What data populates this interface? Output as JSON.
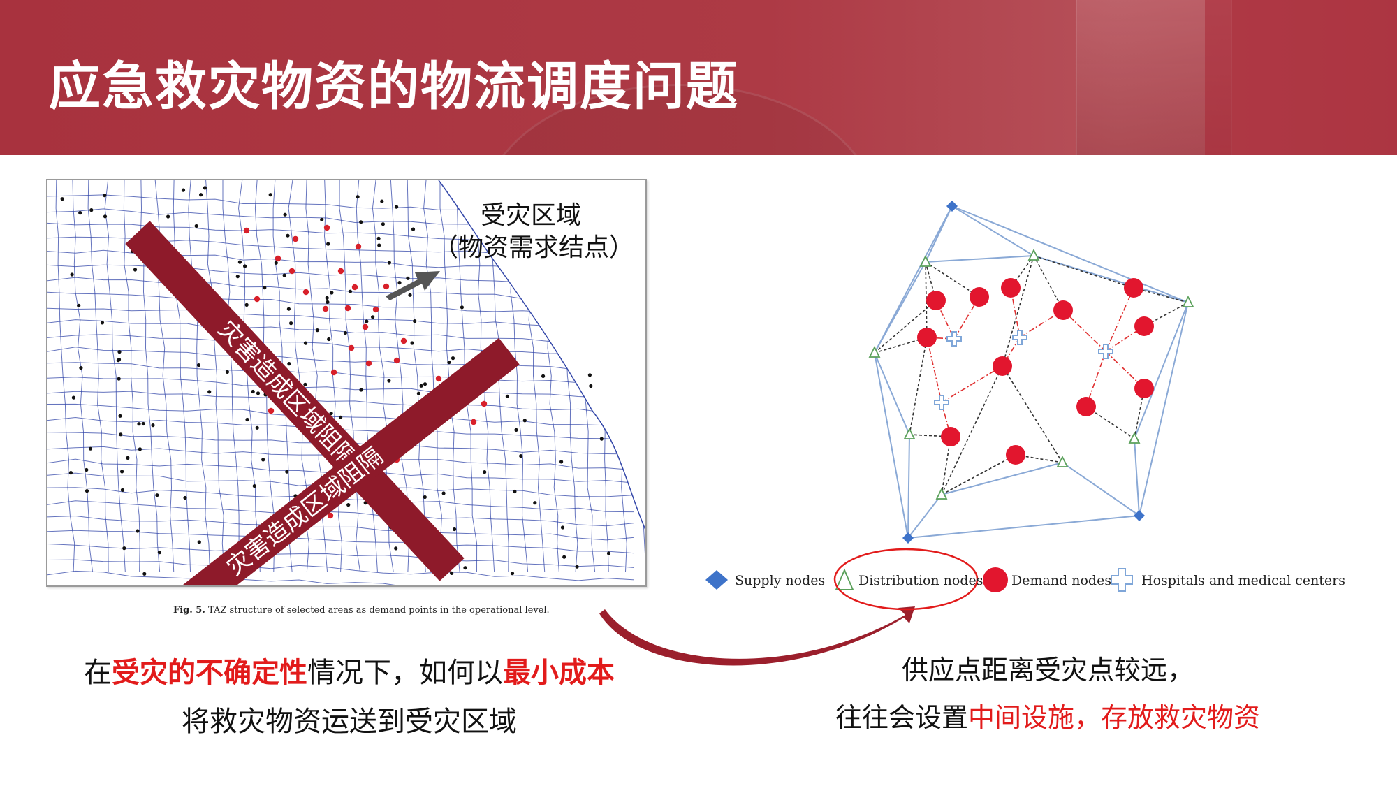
{
  "header": {
    "title": "应急救灾物资的物流调度问题"
  },
  "map_figure": {
    "caption_fig": "Fig. 5.",
    "caption_text": "TAZ structure of selected areas as demand points in the operational level.",
    "banner_1": "灾害造成区域阻隔",
    "banner_2": "灾害造成区域阻隔",
    "area_label_line1": "受灾区域",
    "area_label_line2": "（物资需求结点）"
  },
  "network_diagram": {
    "legend": {
      "supply": "Supply nodes",
      "distribution": "Distribution nodes",
      "demand": "Demand nodes",
      "hospitals": "Hospitals and medical centers"
    }
  },
  "bottom_left": {
    "p1": "在",
    "p2": "受灾的不确定性",
    "p3": "情况下，如何以",
    "p4": "最小成本",
    "p5": "将救灾物资运送到受灾区域"
  },
  "bottom_right": {
    "line1": "供应点距离受灾点较远，",
    "line2_a": "往往会设置",
    "line2_b": "中间设施，存放救灾物资"
  },
  "colors": {
    "header": "#a8323e",
    "banner": "#8e1a2a",
    "highlight_red": "#e21b1b",
    "street_blue": "#3246a8",
    "supply_blue": "#3e73c9",
    "distribution_green": "#5aa05a",
    "demand_red": "#e2162e",
    "edge_blue": "#8aa9d6",
    "arrow_dark_red": "#9b1f2c"
  }
}
